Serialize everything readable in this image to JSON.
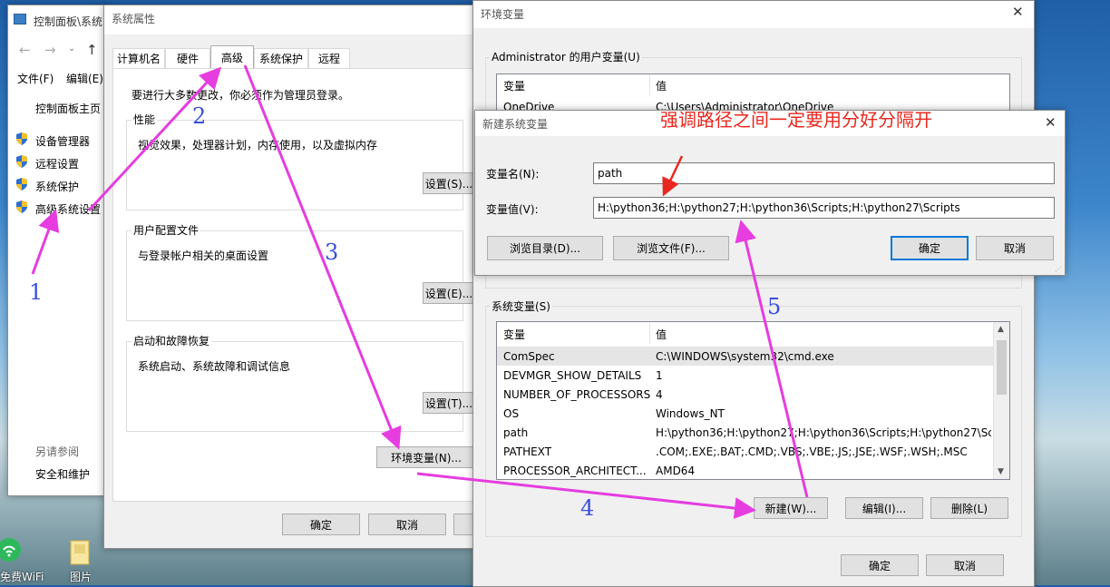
{
  "control_panel": {
    "title": "控制面板\\系统",
    "menu_file": "文件(F)",
    "menu_edit": "编辑(E)",
    "home": "控制面板主页",
    "links": [
      "设备管理器",
      "远程设置",
      "系统保护",
      "高级系统设置"
    ],
    "see_also": "另请参阅",
    "security": "安全和维护"
  },
  "system_properties": {
    "title": "系统属性",
    "tabs": [
      "计算机名",
      "硬件",
      "高级",
      "系统保护",
      "远程"
    ],
    "admin_note": "要进行大多数更改，你必须作为管理员登录。",
    "perf_title": "性能",
    "perf_desc": "视觉效果，处理器计划，内存使用，以及虚拟内存",
    "perf_btn": "设置(S)...",
    "profile_title": "用户配置文件",
    "profile_desc": "与登录帐户相关的桌面设置",
    "profile_btn": "设置(E)...",
    "startup_title": "启动和故障恢复",
    "startup_desc": "系统启动、系统故障和调试信息",
    "startup_btn": "设置(T)...",
    "env_btn": "环境变量(N)...",
    "ok": "确定",
    "cancel": "取消"
  },
  "env_vars": {
    "title": "环境变量",
    "user_group": "Administrator 的用户变量(U)",
    "col_var": "变量",
    "col_val": "值",
    "user_rows": [
      {
        "name": "OneDrive",
        "value": "C:\\Users\\Administrator\\OneDrive"
      }
    ],
    "sys_group": "系统变量(S)",
    "sys_rows": [
      {
        "name": "ComSpec",
        "value": "C:\\WINDOWS\\system32\\cmd.exe"
      },
      {
        "name": "DEVMGR_SHOW_DETAILS",
        "value": "1"
      },
      {
        "name": "NUMBER_OF_PROCESSORS",
        "value": "4"
      },
      {
        "name": "OS",
        "value": "Windows_NT"
      },
      {
        "name": "path",
        "value": "H:\\python36;H:\\python27;H:\\python36\\Scripts;H:\\python27\\Sc..."
      },
      {
        "name": "PATHEXT",
        "value": ".COM;.EXE;.BAT;.CMD;.VBS;.VBE;.JS;.JSE;.WSF;.WSH;.MSC"
      },
      {
        "name": "PROCESSOR_ARCHITECT...",
        "value": "AMD64"
      }
    ],
    "new_btn": "新建(W)...",
    "edit_btn": "编辑(I)...",
    "delete_btn": "删除(L)",
    "ok": "确定",
    "cancel": "取消"
  },
  "new_var": {
    "title": "新建系统变量",
    "name_label": "变量名(N):",
    "name_value": "path",
    "value_label": "变量值(V):",
    "value_value": "H:\\python36;H:\\python27;H:\\python36\\Scripts;H:\\python27\\Scripts",
    "browse_dir": "浏览目录(D)...",
    "browse_file": "浏览文件(F)...",
    "ok": "确定",
    "cancel": "取消"
  },
  "annotations": {
    "n1": "1",
    "n2": "2",
    "n3": "3",
    "n4": "4",
    "n5": "5",
    "note": "强调路径之间一定要用分好分隔开"
  },
  "desktop": {
    "wifi": "免费WiFi",
    "pictures": "图片"
  },
  "colors": {
    "arrow": "#e63ce0",
    "note": "#e8281e",
    "accent": "#0078d7"
  }
}
